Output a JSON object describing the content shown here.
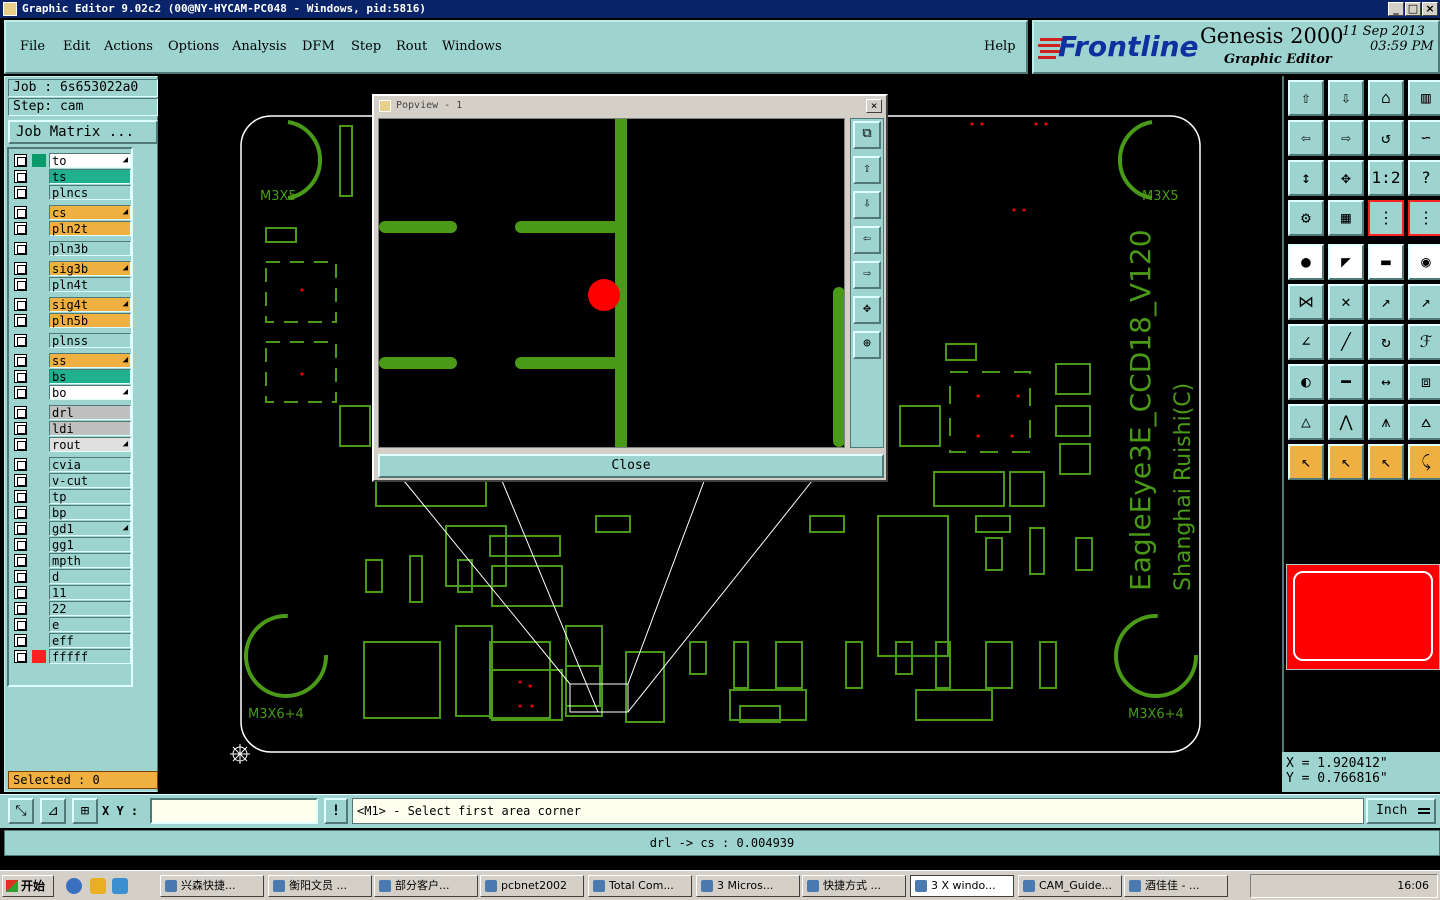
{
  "window": {
    "title": "Graphic Editor 9.02c2 (00@NY-HYCAM-PC048 - Windows, pid:5816)"
  },
  "menu": {
    "items": [
      "File",
      "Edit",
      "Actions",
      "Options",
      "Analysis",
      "DFM",
      "Step",
      "Rout",
      "Windows"
    ],
    "help": "Help"
  },
  "brand": {
    "logo": "Frontline",
    "product": "Genesis 2000",
    "subtitle": "Graphic Editor",
    "date": "11 Sep 2013",
    "time": "03:59 PM"
  },
  "job": {
    "job_label": "Job : 6s653022a0",
    "step_label": "Step: cam",
    "matrix_button": "Job Matrix ..."
  },
  "layers": [
    {
      "name": "to",
      "color": "#ffffff",
      "swatch": "#0a9a6a",
      "arrow": true
    },
    {
      "name": "ts",
      "color": "#20b090",
      "swatch": "",
      "arrow": false
    },
    {
      "name": "plncs",
      "color": "#9ed4d0",
      "swatch": "",
      "arrow": false
    },
    {
      "name": "cs",
      "color": "#f0b040",
      "swatch": "",
      "arrow": true
    },
    {
      "name": "pln2t",
      "color": "#f0b040",
      "swatch": "",
      "arrow": false
    },
    {
      "name": "pln3b",
      "color": "#9ed4d0",
      "swatch": "",
      "arrow": false
    },
    {
      "name": "sig3b",
      "color": "#f0b040",
      "swatch": "",
      "arrow": true
    },
    {
      "name": "pln4t",
      "color": "#9ed4d0",
      "swatch": "",
      "arrow": false
    },
    {
      "name": "sig4t",
      "color": "#f0b040",
      "swatch": "",
      "arrow": true
    },
    {
      "name": "pln5b",
      "color": "#f0b040",
      "swatch": "",
      "arrow": false
    },
    {
      "name": "plnss",
      "color": "#9ed4d0",
      "swatch": "",
      "arrow": false
    },
    {
      "name": "ss",
      "color": "#f0b040",
      "swatch": "",
      "arrow": true
    },
    {
      "name": "bs",
      "color": "#20b090",
      "swatch": "",
      "arrow": false
    },
    {
      "name": "bo",
      "color": "#ffffff",
      "swatch": "",
      "arrow": true
    },
    {
      "name": "drl",
      "color": "#c0c0c0",
      "swatch": "",
      "arrow": false
    },
    {
      "name": "ldi",
      "color": "#c0c0c0",
      "swatch": "",
      "arrow": false
    },
    {
      "name": "rout",
      "color": "#e0e0e0",
      "swatch": "",
      "arrow": true
    },
    {
      "name": "cvia",
      "color": "#9ed4d0",
      "swatch": "",
      "arrow": false
    },
    {
      "name": "v-cut",
      "color": "#9ed4d0",
      "swatch": "",
      "arrow": false
    },
    {
      "name": "tp",
      "color": "#9ed4d0",
      "swatch": "",
      "arrow": false
    },
    {
      "name": "bp",
      "color": "#9ed4d0",
      "swatch": "",
      "arrow": false
    },
    {
      "name": "gd1",
      "color": "#9ed4d0",
      "swatch": "",
      "arrow": true
    },
    {
      "name": "gg1",
      "color": "#9ed4d0",
      "swatch": "",
      "arrow": false
    },
    {
      "name": "mpth",
      "color": "#9ed4d0",
      "swatch": "",
      "arrow": false
    },
    {
      "name": "d",
      "color": "#9ed4d0",
      "swatch": "",
      "arrow": false
    },
    {
      "name": "11",
      "color": "#9ed4d0",
      "swatch": "",
      "arrow": false
    },
    {
      "name": "22",
      "color": "#9ed4d0",
      "swatch": "",
      "arrow": false
    },
    {
      "name": "e",
      "color": "#9ed4d0",
      "swatch": "",
      "arrow": false
    },
    {
      "name": "eff",
      "color": "#9ed4d0",
      "swatch": "",
      "arrow": false
    },
    {
      "name": "fffff",
      "color": "#9ed4d0",
      "swatch": "#ff2020",
      "arrow": false
    }
  ],
  "selected_label": "Selected : 0",
  "board": {
    "labels": [
      "M3X5",
      "M3X5",
      "M3X6+4",
      "M3X6+4"
    ],
    "silk_line1": "EagleEye3E_CCD18_V120",
    "silk_line2": "Shanghai Ruishi(C)"
  },
  "popview": {
    "title": "Popview - 1",
    "close": "Close"
  },
  "coords": {
    "x": "X = 1.920412\"",
    "y": "Y = 0.766816\""
  },
  "input": {
    "xy_label": "X Y :",
    "prompt": "<M1> - Select first area corner",
    "units": "Inch"
  },
  "status": "drl -> cs : 0.004939",
  "taskbar": {
    "start": "开始",
    "items": [
      "兴森快捷...",
      "衡阳文员 ...",
      "部分客户...",
      "pcbnet2002",
      "Total Com...",
      "3 Micros...",
      "快捷方式 ...",
      "3 X windo...",
      "CAM_Guide...",
      "酒佳佳 - ..."
    ],
    "clock": "16:06"
  },
  "colors": {
    "panel": "#9ed4d0",
    "trace": "#4a9a18",
    "board_outline": "#ffffff",
    "highlight": "#ff0000"
  }
}
